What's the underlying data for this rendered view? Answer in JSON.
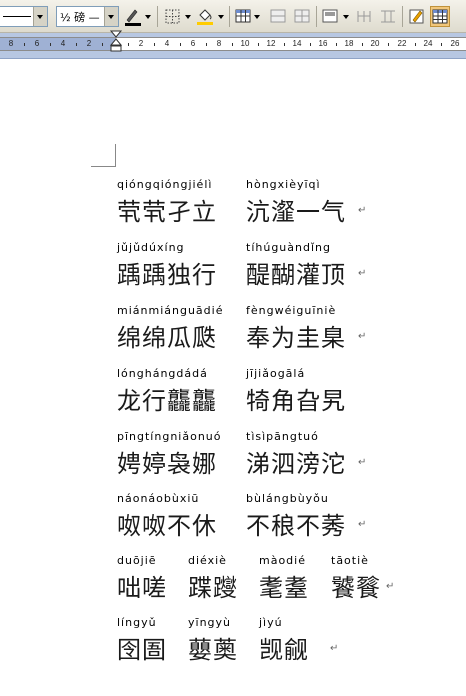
{
  "toolbar": {
    "font_size_value": "½ 磅 —",
    "colors": {
      "line": "#000000",
      "fill": "#ffcc00"
    }
  },
  "ruler": {
    "labels": [
      "8",
      "6",
      "4",
      "2",
      "2",
      "4",
      "6",
      "8",
      "10",
      "12",
      "14",
      "16",
      "18",
      "20",
      "22",
      "24",
      "26"
    ]
  },
  "idioms": [
    {
      "pinyin": "qióngqióngjiélì",
      "hanzi": "茕茕孑立"
    },
    {
      "pinyin": "hòngxièyīqì",
      "hanzi": "沆瀣一气"
    },
    {
      "pinyin": "jǔjǔdúxíng",
      "hanzi": "踽踽独行"
    },
    {
      "pinyin": "tíhúguàndǐng",
      "hanzi": "醍醐灌顶"
    },
    {
      "pinyin": "miánmiánguādié",
      "hanzi": "绵绵瓜瓞"
    },
    {
      "pinyin": "fèngwéiguīniè",
      "hanzi": "奉为圭臬"
    },
    {
      "pinyin": "lónghángdádá",
      "hanzi": "龙行龘龘"
    },
    {
      "pinyin": "jījiǎogālá",
      "hanzi": "犄角旮旯"
    },
    {
      "pinyin": "pīngtíngniǎonuó",
      "hanzi": "娉婷袅娜"
    },
    {
      "pinyin": "tìsìpāngtuó",
      "hanzi": "涕泗滂沱"
    },
    {
      "pinyin": "náonáobùxiū",
      "hanzi": "呶呶不休"
    },
    {
      "pinyin": "bùlángbùyǒu",
      "hanzi": "不稂不莠"
    },
    {
      "pinyin": "duōjiē",
      "hanzi": "咄嗟"
    },
    {
      "pinyin": "diéxiè",
      "hanzi": "蹀躞"
    },
    {
      "pinyin": "màodié",
      "hanzi": "耄耋"
    },
    {
      "pinyin": "tāotiè",
      "hanzi": "饕餮"
    },
    {
      "pinyin": "língyǔ",
      "hanzi": "囹圄"
    },
    {
      "pinyin": "yīngyù",
      "hanzi": "蘡薁"
    },
    {
      "pinyin": "jìyú",
      "hanzi": "觊觎"
    }
  ],
  "paragraph_mark": "↵"
}
